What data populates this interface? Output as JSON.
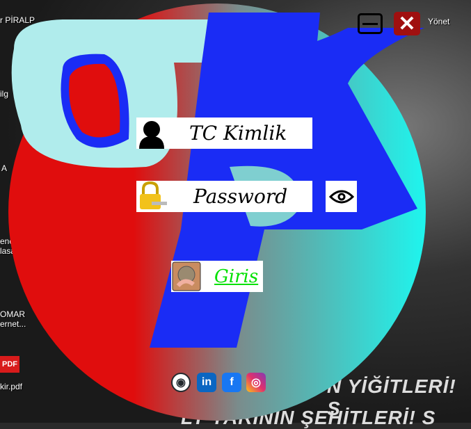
{
  "desktop": {
    "icon_labels": [
      "r PİRALP",
      "Yönet",
      "ilg",
      "A",
      "ene\nlasa",
      "OMAR\nernet...",
      "kir.pdf"
    ],
    "pdf_badge": "PDF",
    "wallpaper_banner_1": "N YİĞİTLERİ! S",
    "wallpaper_banner_2": "LY YARININ ŞEHİTLERİ! S"
  },
  "window": {
    "minimize_icon": "minimize-icon",
    "close_icon": "close-icon",
    "logo_text": "BP"
  },
  "login": {
    "tc_placeholder": "TC Kimlik",
    "password_placeholder": "Password",
    "show_password_icon": "eye-icon",
    "login_label": "Giris",
    "login_color": "#00e000"
  },
  "social": [
    {
      "name": "github",
      "glyph": "◉",
      "color": "#24292e"
    },
    {
      "name": "linkedin",
      "glyph": "in",
      "color": "#0a66c2"
    },
    {
      "name": "facebook",
      "glyph": "f",
      "color": "#1877f2"
    },
    {
      "name": "instagram",
      "glyph": "◎",
      "color": "#d6249f"
    }
  ]
}
